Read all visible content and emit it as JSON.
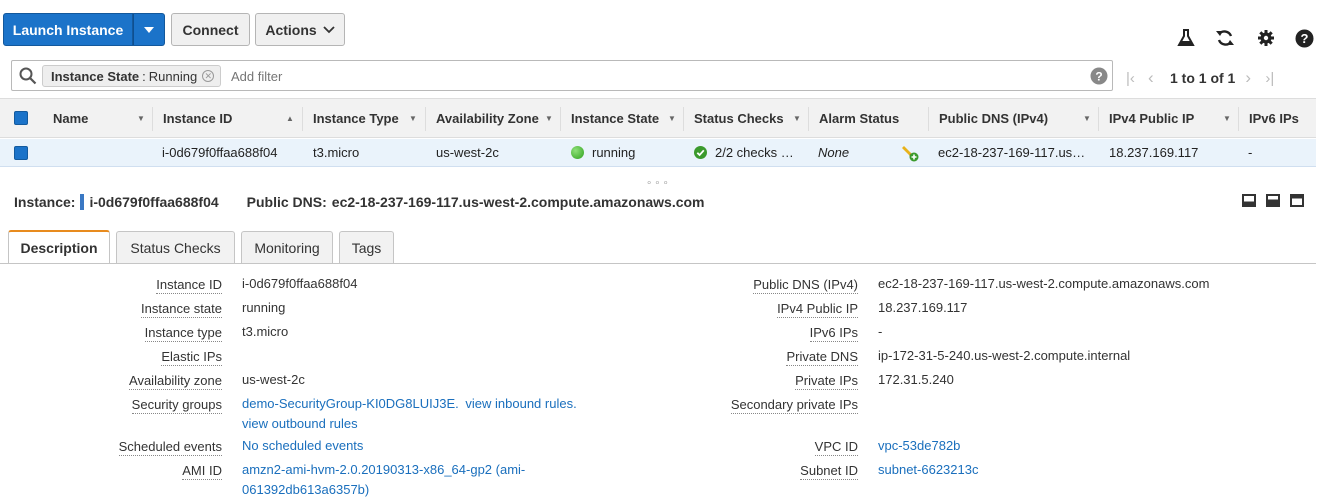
{
  "toolbar": {
    "launch": "Launch Instance",
    "connect": "Connect",
    "actions": "Actions"
  },
  "filter": {
    "chip_key": "Instance State",
    "chip_sep": ":",
    "chip_value": "Running",
    "placeholder": "Add filter"
  },
  "pager": {
    "text": "1 to 1 of 1"
  },
  "columns": [
    "Name",
    "Instance ID",
    "Instance Type",
    "Availability Zone",
    "Instance State",
    "Status Checks",
    "Alarm Status",
    "Public DNS (IPv4)",
    "IPv4 Public IP",
    "IPv6 IPs"
  ],
  "row": {
    "name": "",
    "instance_id": "i-0d679f0ffaa688f04",
    "instance_type": "t3.micro",
    "az": "us-west-2c",
    "state": "running",
    "checks": "2/2 checks …",
    "alarm": "None",
    "public_dns": "ec2-18-237-169-117.us…",
    "ipv4": "18.237.169.117",
    "ipv6": "-"
  },
  "detail": {
    "instance_label": "Instance:",
    "instance_id": "i-0d679f0ffaa688f04",
    "dns_label": "Public DNS:",
    "dns_value": "ec2-18-237-169-117.us-west-2.compute.amazonaws.com",
    "tabs": [
      "Description",
      "Status Checks",
      "Monitoring",
      "Tags"
    ]
  },
  "desc_left": [
    {
      "label": "Instance ID",
      "value": "i-0d679f0ffaa688f04"
    },
    {
      "label": "Instance state",
      "value": "running"
    },
    {
      "label": "Instance type",
      "value": "t3.micro"
    },
    {
      "label": "Elastic IPs",
      "value": ""
    },
    {
      "label": "Availability zone",
      "value": "us-west-2c"
    },
    {
      "label": "Security groups",
      "value": "demo-SecurityGroup-KI0DG8LUIJ3E.",
      "value2": "view inbound rules.",
      "value3": "view outbound rules"
    },
    {
      "label": "Scheduled events",
      "value": "No scheduled events"
    },
    {
      "label": "AMI ID",
      "value": "amzn2-ami-hvm-2.0.20190313-x86_64-gp2 (ami-",
      "value2": "061392db613a6357b)"
    }
  ],
  "desc_right": [
    {
      "label": "Public DNS (IPv4)",
      "value": "ec2-18-237-169-117.us-west-2.compute.amazonaws.com"
    },
    {
      "label": "IPv4 Public IP",
      "value": "18.237.169.117"
    },
    {
      "label": "IPv6 IPs",
      "value": "-"
    },
    {
      "label": "Private DNS",
      "value": "ip-172-31-5-240.us-west-2.compute.internal"
    },
    {
      "label": "Private IPs",
      "value": "172.31.5.240"
    },
    {
      "label": "Secondary private IPs",
      "value": ""
    },
    {
      "label": "VPC ID",
      "value": "vpc-53de782b"
    },
    {
      "label": "Subnet ID",
      "value": "subnet-6623213c"
    }
  ],
  "colors": {
    "primary": "#1b73c9",
    "link": "#1a6fbd",
    "running": "#3fb62e",
    "tab_accent": "#e88b1e"
  }
}
